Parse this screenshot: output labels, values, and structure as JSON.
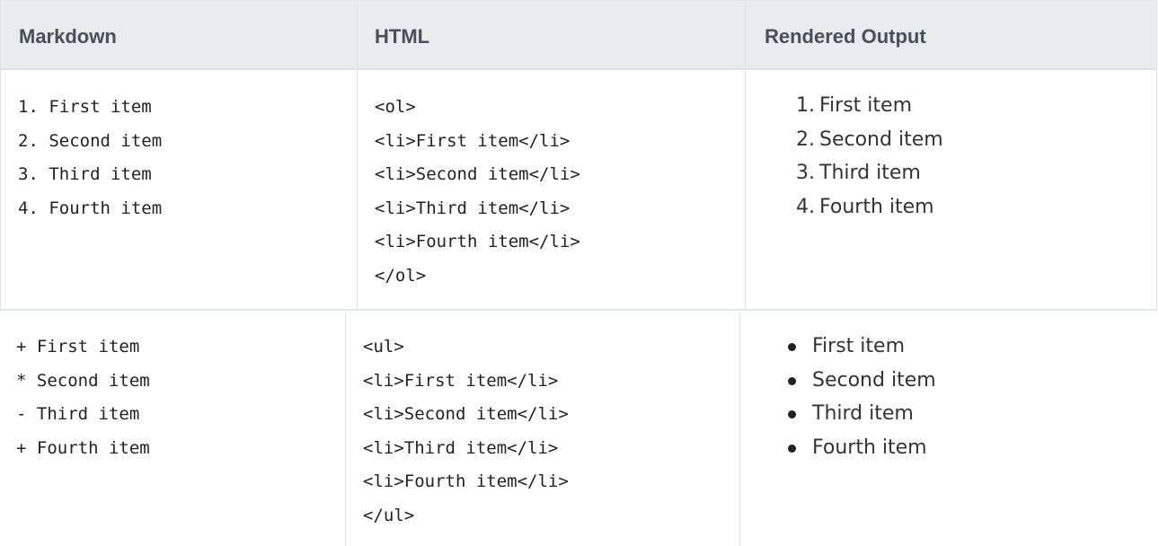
{
  "table": {
    "headers": [
      "Markdown",
      "HTML",
      "Rendered Output"
    ],
    "rows": [
      {
        "markdown": [
          "1. First item",
          "2. Second item",
          "3. Third item",
          "4. Fourth item"
        ],
        "html": [
          "<ol>",
          "<li>First item</li>",
          "<li>Second item</li>",
          "<li>Third item</li>",
          "<li>Fourth item</li>",
          "</ol>"
        ],
        "rendered": {
          "type": "ordered",
          "markers": [
            "1.",
            "2.",
            "3.",
            "4."
          ],
          "items": [
            "First item",
            "Second item",
            "Third item",
            "Fourth item"
          ]
        }
      },
      {
        "markdown": [
          "+ First item",
          "* Second item",
          "- Third item",
          "+ Fourth item"
        ],
        "html": [
          "<ul>",
          "<li>First item</li>",
          "<li>Second item</li>",
          "<li>Third item</li>",
          "<li>Fourth item</li>",
          "</ul>"
        ],
        "rendered": {
          "type": "unordered",
          "items": [
            "First item",
            "Second item",
            "Third item",
            "Fourth item"
          ]
        }
      }
    ]
  },
  "colors": {
    "header_background": "#e9ecef",
    "header_text": "#495057",
    "border": "#dee2e6",
    "body_text": "#333333"
  }
}
